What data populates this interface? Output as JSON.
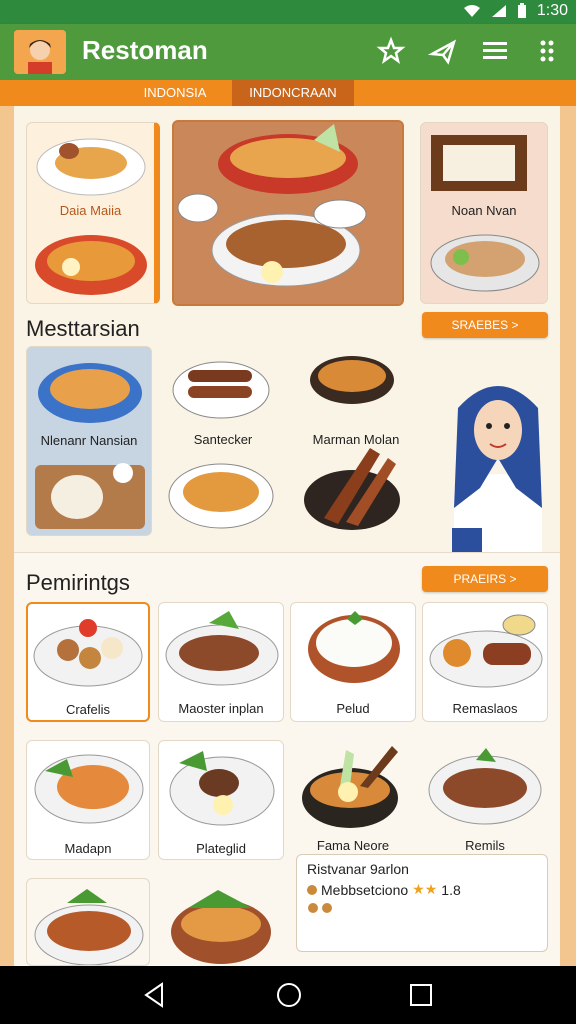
{
  "status": {
    "time": "1:30"
  },
  "appbar": {
    "title": "Restoman",
    "icons": [
      "star-icon",
      "plane-icon",
      "menu-lines-icon",
      "more-icon"
    ]
  },
  "tabs": [
    {
      "label": "INDONSIA"
    },
    {
      "label": "INDONCRAAN"
    }
  ],
  "featured": [
    {
      "label": "Daia Maiia"
    },
    {
      "label": ""
    },
    {
      "label": "Noan Nvan"
    }
  ],
  "section1": {
    "title": "Mesttarsian",
    "button": "SRAEBES >",
    "items": [
      {
        "label": "Nlenanr Nansian"
      },
      {
        "label": "Santecker"
      },
      {
        "label": "Marman Molan"
      }
    ]
  },
  "section2": {
    "title": "Pemirintgs",
    "button": "PRAEIRS >",
    "items": [
      {
        "label": "Crafelis"
      },
      {
        "label": "Maoster inplan"
      },
      {
        "label": "Pelud"
      },
      {
        "label": "Remaslaos"
      },
      {
        "label": "Madapn"
      },
      {
        "label": "Plateglid"
      },
      {
        "label": "Fama Neore"
      },
      {
        "label": "Remils"
      }
    ]
  },
  "review": {
    "line1": "Ristvanar 9arlon",
    "line2": "Mebbsetciono",
    "rating": "1.8"
  },
  "colors": {
    "green": "#4e9a3c",
    "orange": "#f08a1c",
    "cream": "#faf4e6"
  }
}
